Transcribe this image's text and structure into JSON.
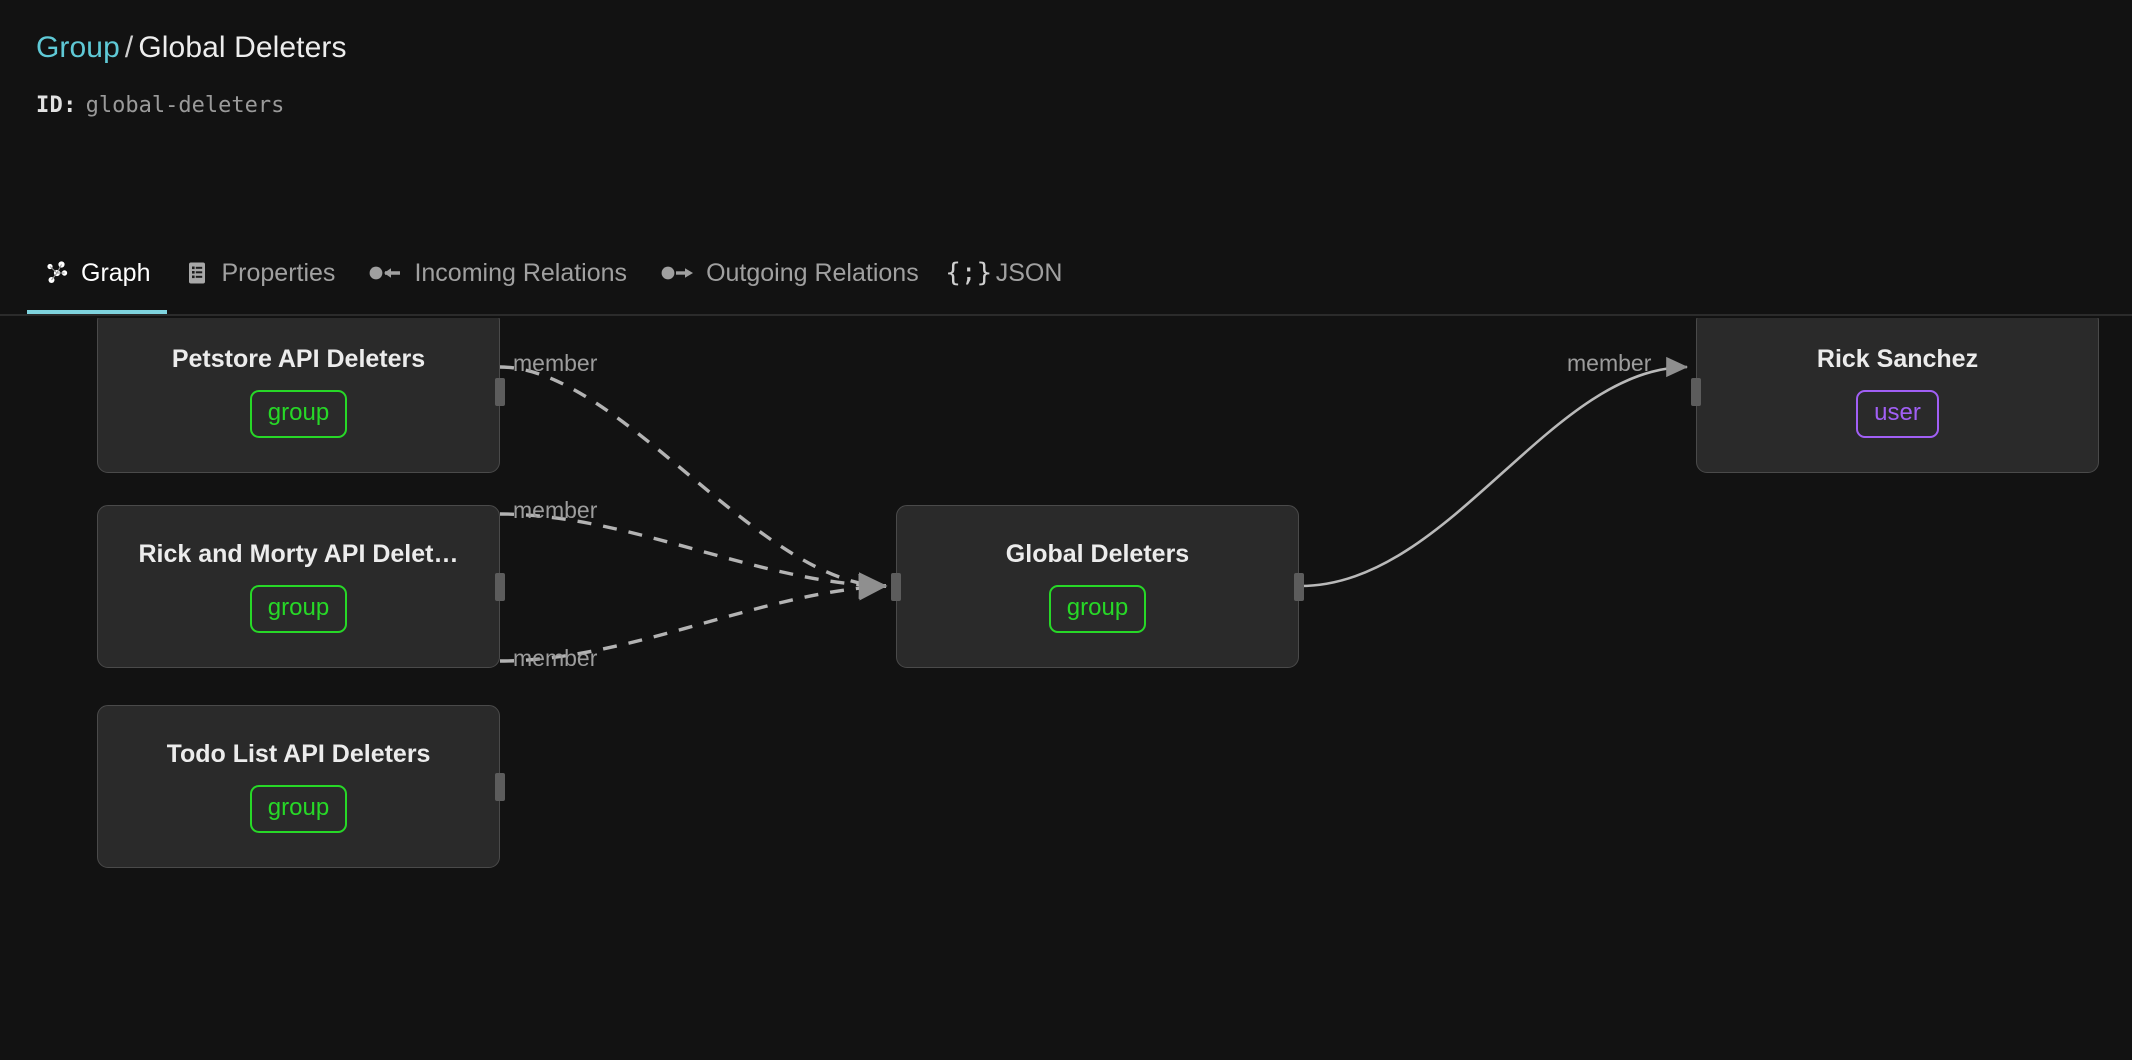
{
  "header": {
    "breadcrumb_type": "Group",
    "breadcrumb_separator": "/",
    "breadcrumb_name": "Global Deleters",
    "id_label": "ID:",
    "id_value": "global-deleters"
  },
  "tabs": [
    {
      "label": "Graph",
      "icon": "graph-icon",
      "active": true
    },
    {
      "label": "Properties",
      "icon": "properties-icon",
      "active": false
    },
    {
      "label": "Incoming Relations",
      "icon": "incoming-relations-icon",
      "active": false
    },
    {
      "label": "Outgoing Relations",
      "icon": "outgoing-relations-icon",
      "active": false
    },
    {
      "label": "JSON",
      "icon": "json-icon",
      "active": false,
      "glyph": "{;}"
    }
  ],
  "graph": {
    "nodes": [
      {
        "title": "Petstore API Deleters",
        "badge": "group",
        "kind": "group"
      },
      {
        "title": "Rick and Morty API Delet…",
        "badge": "group",
        "kind": "group"
      },
      {
        "title": "Todo List API Deleters",
        "badge": "group",
        "kind": "group"
      },
      {
        "title": "Global Deleters",
        "badge": "group",
        "kind": "group"
      },
      {
        "title": "Rick Sanchez",
        "badge": "user",
        "kind": "user"
      }
    ],
    "edges": [
      {
        "label": "member",
        "style": "dashed"
      },
      {
        "label": "member",
        "style": "dashed"
      },
      {
        "label": "member",
        "style": "dashed"
      },
      {
        "label": "member",
        "style": "solid"
      }
    ]
  },
  "colors": {
    "background": "#121212",
    "accent": "#5fc9d6",
    "group_badge": "#27d827",
    "user_badge": "#a15ff5",
    "node_fill": "#2a2a2a",
    "node_border": "#4a4a4a",
    "edge": "#9c9c9c"
  }
}
